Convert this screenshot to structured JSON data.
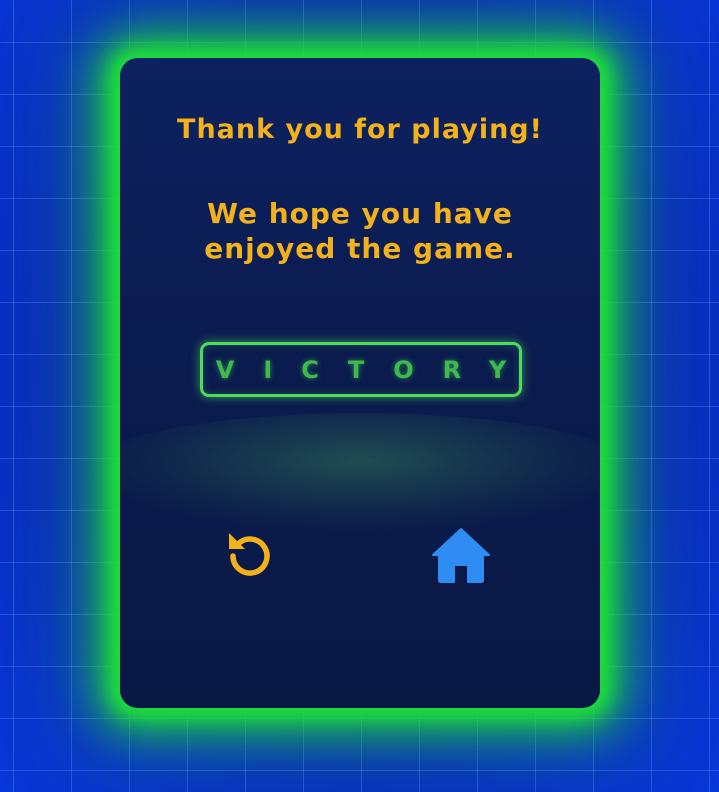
{
  "end_screen": {
    "title": "Thank you for playing!",
    "message": "We hope you have enjoyed the game.",
    "result_label": "VICTORY",
    "restart_icon": "restart-icon",
    "home_icon": "home-icon"
  },
  "colors": {
    "text_accent": "#f3b11a",
    "victory_green": "#4fdc5a",
    "panel_glow": "#1fe03a",
    "home_icon_blue": "#2f8cf2",
    "background_blue": "#0a2fc8",
    "panel_navy": "#0b1b4e"
  }
}
